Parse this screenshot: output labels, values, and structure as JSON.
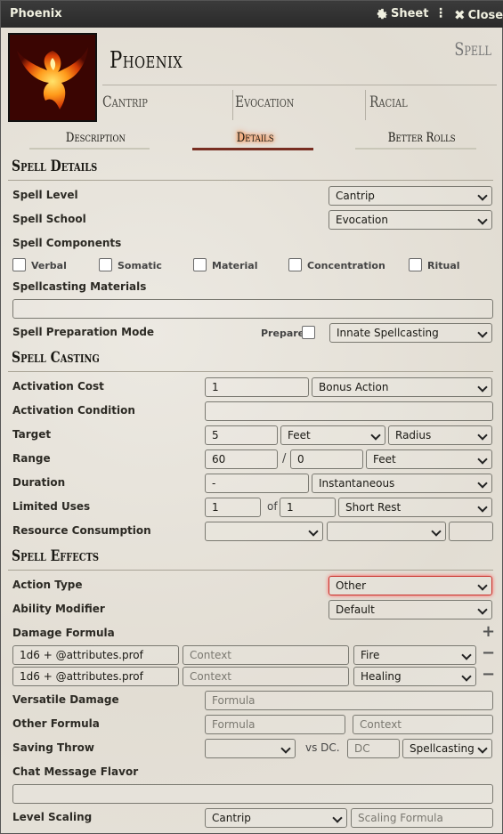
{
  "window": {
    "title": "Phoenix",
    "sheet_label": "Sheet",
    "close_label": "Close"
  },
  "header": {
    "name": "Phoenix",
    "item_type": "Spell",
    "level": "Cantrip",
    "school": "Evocation",
    "source": "Racial"
  },
  "tabs": [
    "Description",
    "Details",
    "Better Rolls"
  ],
  "details": {
    "heading": "Spell Details",
    "spell_level_label": "Spell Level",
    "spell_level": "Cantrip",
    "spell_school_label": "Spell School",
    "spell_school": "Evocation",
    "components_label": "Spell Components",
    "components": [
      "Verbal",
      "Somatic",
      "Material",
      "Concentration",
      "Ritual"
    ],
    "materials_label": "Spellcasting Materials",
    "materials_value": "",
    "prep_mode_label": "Spell Preparation Mode",
    "prepared_label": "Prepared",
    "prep_mode": "Innate Spellcasting"
  },
  "casting": {
    "heading": "Spell Casting",
    "activation_cost_label": "Activation Cost",
    "activation_cost": "1",
    "activation_type": "Bonus Action",
    "activation_condition_label": "Activation Condition",
    "activation_condition": "",
    "target_label": "Target",
    "target_value": "5",
    "target_units": "Feet",
    "target_type": "Radius",
    "range_label": "Range",
    "range_value": "60",
    "range_sep": "/",
    "range_long": "0",
    "range_units": "Feet",
    "duration_label": "Duration",
    "duration_value": "-",
    "duration_units": "Instantaneous",
    "uses_label": "Limited Uses",
    "uses_value": "1",
    "uses_of": "of",
    "uses_max": "1",
    "uses_per": "Short Rest",
    "consumption_label": "Resource Consumption"
  },
  "effects": {
    "heading": "Spell Effects",
    "action_type_label": "Action Type",
    "action_type": "Other",
    "ability_label": "Ability Modifier",
    "ability": "Default",
    "damage_label": "Damage Formula",
    "damage_rows": [
      {
        "formula": "1d6 + @attributes.prof",
        "context_ph": "Context",
        "type": "Fire"
      },
      {
        "formula": "1d6 + @attributes.prof",
        "context_ph": "Context",
        "type": "Healing"
      }
    ],
    "versatile_label": "Versatile Damage",
    "versatile_ph": "Formula",
    "other_label": "Other Formula",
    "other_ph": "Formula",
    "other_context_ph": "Context",
    "saving_label": "Saving Throw",
    "vs_dc": "vs DC.",
    "dc_ph": "DC",
    "dc_scaling": "Spellcasting",
    "chat_label": "Chat Message Flavor",
    "scaling_label": "Level Scaling",
    "scaling_mode": "Cantrip",
    "scaling_ph": "Scaling Formula"
  }
}
